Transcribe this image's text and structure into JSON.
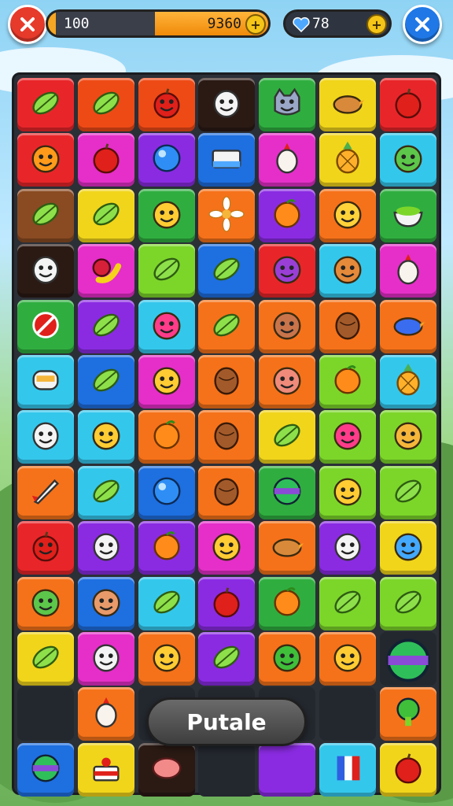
{
  "hud": {
    "left_counter": "100",
    "score": "9360",
    "right_counter": "78"
  },
  "toast": {
    "label": "Putale"
  },
  "colors": {
    "red": "#e8262a",
    "orange": "#f5721a",
    "yellow": "#f1d51b",
    "lime": "#7cd62a",
    "green": "#2fae3f",
    "cyan": "#34c7ec",
    "blue": "#1e6fe0",
    "purple": "#8a2be2",
    "magenta": "#e52fc8",
    "pink": "#f23c9a",
    "brown": "#8a4b22",
    "dark": "#2b1a14",
    "orange_red": "#ee4a16"
  },
  "grid": [
    [
      [
        "red",
        "leaf-icon"
      ],
      [
        "orange_red",
        "leaf-icon"
      ],
      [
        "orange_red",
        "apple-face-icon"
      ],
      [
        "dark",
        "ghost-face-icon"
      ],
      [
        "green",
        "cat-face-icon"
      ],
      [
        "yellow",
        "bird-icon"
      ],
      [
        "red",
        "apple-icon"
      ]
    ],
    [
      [
        "red",
        "orange-face-icon"
      ],
      [
        "magenta",
        "apple-icon"
      ],
      [
        "purple",
        "ball-icon"
      ],
      [
        "blue",
        "box-icon"
      ],
      [
        "magenta",
        "radish-icon"
      ],
      [
        "yellow",
        "pineapple-icon"
      ],
      [
        "cyan",
        "frog-face-icon"
      ]
    ],
    [
      [
        "brown",
        "leaf-icon"
      ],
      [
        "yellow",
        "leaf-icon"
      ],
      [
        "green",
        "smiley-icon"
      ],
      [
        "orange",
        "flower-icon"
      ],
      [
        "purple",
        "orange-icon"
      ],
      [
        "orange",
        "crown-face-icon"
      ],
      [
        "green",
        "bowl-icon"
      ]
    ],
    [
      [
        "dark",
        "ghost-face-icon"
      ],
      [
        "magenta",
        "berry-banana-icon"
      ],
      [
        "lime",
        "leaf-icon"
      ],
      [
        "blue",
        "leaf-icon"
      ],
      [
        "red",
        "plum-face-icon"
      ],
      [
        "cyan",
        "nut-face-icon"
      ],
      [
        "magenta",
        "radish-icon"
      ]
    ],
    [
      [
        "green",
        "no-entry-icon"
      ],
      [
        "purple",
        "leaf-icon"
      ],
      [
        "cyan",
        "berry-face-icon"
      ],
      [
        "orange",
        "leaf-icon"
      ],
      [
        "orange",
        "bear-face-icon"
      ],
      [
        "orange",
        "nut-icon"
      ],
      [
        "orange",
        "blue-bird-icon"
      ]
    ],
    [
      [
        "cyan",
        "face-mask-icon"
      ],
      [
        "blue",
        "leaf-icon"
      ],
      [
        "magenta",
        "smiley-icon"
      ],
      [
        "orange",
        "nut-icon"
      ],
      [
        "orange",
        "pig-face-icon"
      ],
      [
        "lime",
        "orange-icon"
      ],
      [
        "cyan",
        "pineapple-icon"
      ]
    ],
    [
      [
        "cyan",
        "robot-face-icon"
      ],
      [
        "cyan",
        "smiley-icon"
      ],
      [
        "orange",
        "pumpkin-icon"
      ],
      [
        "orange",
        "coconut-icon"
      ],
      [
        "yellow",
        "leaf-icon"
      ],
      [
        "lime",
        "berry-face-icon"
      ],
      [
        "lime",
        "burger-face-icon"
      ]
    ],
    [
      [
        "orange",
        "rocket-icon"
      ],
      [
        "cyan",
        "leaf-icon"
      ],
      [
        "blue",
        "eyeball-icon"
      ],
      [
        "orange",
        "nut-icon"
      ],
      [
        "green",
        "ball-face-icon"
      ],
      [
        "lime",
        "smiley-icon"
      ],
      [
        "lime",
        "leaf-icon"
      ]
    ],
    [
      [
        "red",
        "apple-face-icon"
      ],
      [
        "purple",
        "clown-face-icon"
      ],
      [
        "purple",
        "orange-icon"
      ],
      [
        "magenta",
        "smiley-icon"
      ],
      [
        "orange",
        "bird-icon"
      ],
      [
        "purple",
        "egg-face-icon"
      ],
      [
        "yellow",
        "blue-face-icon"
      ]
    ],
    [
      [
        "orange",
        "frog-face-icon"
      ],
      [
        "blue",
        "boy-face-icon"
      ],
      [
        "cyan",
        "leaf-icon"
      ],
      [
        "purple",
        "apple-icon"
      ],
      [
        "green",
        "orange-icon"
      ],
      [
        "lime",
        "leaf-icon"
      ],
      [
        "lime",
        "leaf-icon"
      ]
    ],
    [
      [
        "yellow",
        "leaf-icon"
      ],
      [
        "magenta",
        "ghost-face-icon"
      ],
      [
        "orange",
        "smiley-icon"
      ],
      [
        "purple",
        "leaf-icon"
      ],
      [
        "orange",
        "slime-face-icon"
      ],
      [
        "orange",
        "smiley-icon"
      ],
      [
        "empty",
        "striped-ball-icon"
      ]
    ],
    [
      [
        "empty",
        ""
      ],
      [
        "orange",
        "egg-icon"
      ],
      [
        "empty",
        ""
      ],
      [
        "empty",
        ""
      ],
      [
        "empty",
        ""
      ],
      [
        "empty",
        ""
      ],
      [
        "orange",
        "broccoli-icon"
      ]
    ],
    [
      [
        "blue",
        "ball-face-icon"
      ],
      [
        "yellow",
        "cake-icon"
      ],
      [
        "dark",
        "coin-icon"
      ],
      [
        "empty",
        ""
      ],
      [
        "purple",
        ""
      ],
      [
        "cyan",
        "flag-icon"
      ],
      [
        "yellow",
        "apple-icon"
      ]
    ]
  ]
}
